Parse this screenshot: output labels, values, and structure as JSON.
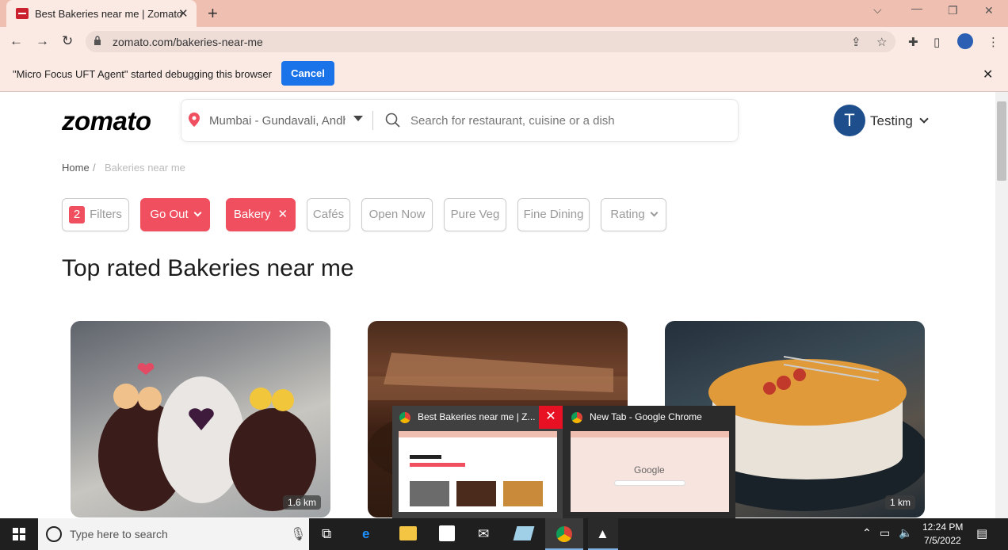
{
  "browser": {
    "tab_title": "Best Bakeries near me | Zomato",
    "url": "zomato.com/bakeries-near-me",
    "infobar_text": "\"Micro Focus UFT Agent\" started debugging this browser",
    "cancel_label": "Cancel"
  },
  "page": {
    "logo": "zomato",
    "location": "Mumbai - Gundavali, Andheri",
    "search_placeholder": "Search for restaurant, cuisine or a dish",
    "user_initial": "T",
    "user_name": "Testing",
    "breadcrumb": {
      "home": "Home",
      "separator": "/",
      "current": "Bakeries near me"
    },
    "filters": {
      "count": "2",
      "filters_label": "Filters",
      "go_out": "Go Out",
      "bakery": "Bakery",
      "cafes": "Cafés",
      "open_now": "Open Now",
      "pure_veg": "Pure Veg",
      "fine_dining": "Fine Dining",
      "rating": "Rating"
    },
    "heading": "Top rated Bakeries near me",
    "cards": [
      {
        "distance": "1.6 km"
      },
      {
        "distance": ""
      },
      {
        "distance": "1 km"
      }
    ]
  },
  "thumbnail_popup": {
    "items": [
      {
        "title": "Best Bakeries near me | Z..."
      },
      {
        "title": "New Tab - Google Chrome"
      }
    ],
    "google_label": "Google"
  },
  "taskbar": {
    "search_placeholder": "Type here to search",
    "time": "12:24 PM",
    "date": "7/5/2022"
  },
  "colors": {
    "brand": "#ef4f5f",
    "browser_frame": "#efc0b2",
    "cancel_button": "#1a73e8"
  }
}
